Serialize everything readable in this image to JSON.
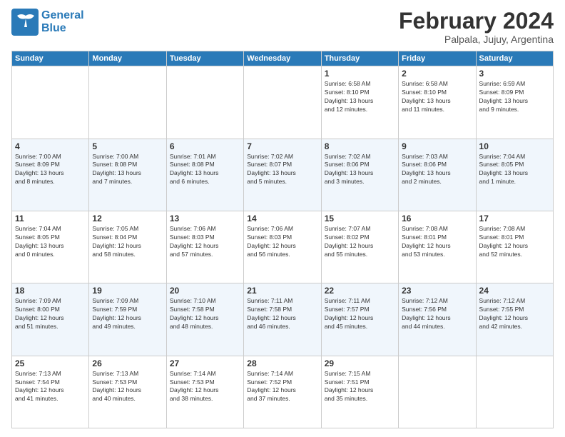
{
  "logo": {
    "line1": "General",
    "line2": "Blue"
  },
  "title": "February 2024",
  "subtitle": "Palpala, Jujuy, Argentina",
  "days_of_week": [
    "Sunday",
    "Monday",
    "Tuesday",
    "Wednesday",
    "Thursday",
    "Friday",
    "Saturday"
  ],
  "weeks": [
    [
      {
        "day": "",
        "info": ""
      },
      {
        "day": "",
        "info": ""
      },
      {
        "day": "",
        "info": ""
      },
      {
        "day": "",
        "info": ""
      },
      {
        "day": "1",
        "info": "Sunrise: 6:58 AM\nSunset: 8:10 PM\nDaylight: 13 hours\nand 12 minutes."
      },
      {
        "day": "2",
        "info": "Sunrise: 6:58 AM\nSunset: 8:10 PM\nDaylight: 13 hours\nand 11 minutes."
      },
      {
        "day": "3",
        "info": "Sunrise: 6:59 AM\nSunset: 8:09 PM\nDaylight: 13 hours\nand 9 minutes."
      }
    ],
    [
      {
        "day": "4",
        "info": "Sunrise: 7:00 AM\nSunset: 8:09 PM\nDaylight: 13 hours\nand 8 minutes."
      },
      {
        "day": "5",
        "info": "Sunrise: 7:00 AM\nSunset: 8:08 PM\nDaylight: 13 hours\nand 7 minutes."
      },
      {
        "day": "6",
        "info": "Sunrise: 7:01 AM\nSunset: 8:08 PM\nDaylight: 13 hours\nand 6 minutes."
      },
      {
        "day": "7",
        "info": "Sunrise: 7:02 AM\nSunset: 8:07 PM\nDaylight: 13 hours\nand 5 minutes."
      },
      {
        "day": "8",
        "info": "Sunrise: 7:02 AM\nSunset: 8:06 PM\nDaylight: 13 hours\nand 3 minutes."
      },
      {
        "day": "9",
        "info": "Sunrise: 7:03 AM\nSunset: 8:06 PM\nDaylight: 13 hours\nand 2 minutes."
      },
      {
        "day": "10",
        "info": "Sunrise: 7:04 AM\nSunset: 8:05 PM\nDaylight: 13 hours\nand 1 minute."
      }
    ],
    [
      {
        "day": "11",
        "info": "Sunrise: 7:04 AM\nSunset: 8:05 PM\nDaylight: 13 hours\nand 0 minutes."
      },
      {
        "day": "12",
        "info": "Sunrise: 7:05 AM\nSunset: 8:04 PM\nDaylight: 12 hours\nand 58 minutes."
      },
      {
        "day": "13",
        "info": "Sunrise: 7:06 AM\nSunset: 8:03 PM\nDaylight: 12 hours\nand 57 minutes."
      },
      {
        "day": "14",
        "info": "Sunrise: 7:06 AM\nSunset: 8:03 PM\nDaylight: 12 hours\nand 56 minutes."
      },
      {
        "day": "15",
        "info": "Sunrise: 7:07 AM\nSunset: 8:02 PM\nDaylight: 12 hours\nand 55 minutes."
      },
      {
        "day": "16",
        "info": "Sunrise: 7:08 AM\nSunset: 8:01 PM\nDaylight: 12 hours\nand 53 minutes."
      },
      {
        "day": "17",
        "info": "Sunrise: 7:08 AM\nSunset: 8:01 PM\nDaylight: 12 hours\nand 52 minutes."
      }
    ],
    [
      {
        "day": "18",
        "info": "Sunrise: 7:09 AM\nSunset: 8:00 PM\nDaylight: 12 hours\nand 51 minutes."
      },
      {
        "day": "19",
        "info": "Sunrise: 7:09 AM\nSunset: 7:59 PM\nDaylight: 12 hours\nand 49 minutes."
      },
      {
        "day": "20",
        "info": "Sunrise: 7:10 AM\nSunset: 7:58 PM\nDaylight: 12 hours\nand 48 minutes."
      },
      {
        "day": "21",
        "info": "Sunrise: 7:11 AM\nSunset: 7:58 PM\nDaylight: 12 hours\nand 46 minutes."
      },
      {
        "day": "22",
        "info": "Sunrise: 7:11 AM\nSunset: 7:57 PM\nDaylight: 12 hours\nand 45 minutes."
      },
      {
        "day": "23",
        "info": "Sunrise: 7:12 AM\nSunset: 7:56 PM\nDaylight: 12 hours\nand 44 minutes."
      },
      {
        "day": "24",
        "info": "Sunrise: 7:12 AM\nSunset: 7:55 PM\nDaylight: 12 hours\nand 42 minutes."
      }
    ],
    [
      {
        "day": "25",
        "info": "Sunrise: 7:13 AM\nSunset: 7:54 PM\nDaylight: 12 hours\nand 41 minutes."
      },
      {
        "day": "26",
        "info": "Sunrise: 7:13 AM\nSunset: 7:53 PM\nDaylight: 12 hours\nand 40 minutes."
      },
      {
        "day": "27",
        "info": "Sunrise: 7:14 AM\nSunset: 7:53 PM\nDaylight: 12 hours\nand 38 minutes."
      },
      {
        "day": "28",
        "info": "Sunrise: 7:14 AM\nSunset: 7:52 PM\nDaylight: 12 hours\nand 37 minutes."
      },
      {
        "day": "29",
        "info": "Sunrise: 7:15 AM\nSunset: 7:51 PM\nDaylight: 12 hours\nand 35 minutes."
      },
      {
        "day": "",
        "info": ""
      },
      {
        "day": "",
        "info": ""
      }
    ]
  ]
}
